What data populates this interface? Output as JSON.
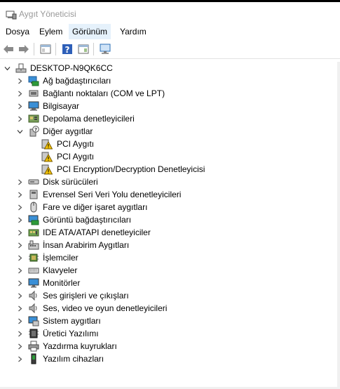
{
  "window": {
    "title": "Aygıt Yöneticisi"
  },
  "menu": [
    "Dosya",
    "Eylem",
    "Görünüm",
    "Yardım"
  ],
  "toolbar": {
    "buttons": [
      "back-arrow-icon",
      "forward-arrow-icon",
      "properties-pane-icon",
      "help-icon",
      "device-properties-icon",
      "monitor-scan-icon"
    ]
  },
  "tree": {
    "root": "DESKTOP-N9QK6CC",
    "items": [
      {
        "label": "Ağ bağdaştırıcıları",
        "icon": "network-adapter-icon",
        "expanded": false
      },
      {
        "label": "Bağlantı noktaları (COM ve LPT)",
        "icon": "port-icon",
        "expanded": false
      },
      {
        "label": "Bilgisayar",
        "icon": "computer-icon",
        "expanded": false
      },
      {
        "label": "Depolama denetleyicileri",
        "icon": "storage-controller-icon",
        "expanded": false
      },
      {
        "label": "Diğer aygıtlar",
        "icon": "other-devices-icon",
        "expanded": true,
        "children": [
          "PCI Aygıtı",
          "PCI Aygıtı",
          "PCI Encryption/Decryption Denetleyicisi"
        ]
      },
      {
        "label": "Disk sürücüleri",
        "icon": "disk-drive-icon",
        "expanded": false
      },
      {
        "label": "Evrensel Seri Veri Yolu denetleyicileri",
        "icon": "usb-controller-icon",
        "expanded": false
      },
      {
        "label": "Fare ve diğer işaret aygıtları",
        "icon": "mouse-icon",
        "expanded": false
      },
      {
        "label": "Görüntü bağdaştırıcıları",
        "icon": "display-adapter-icon",
        "expanded": false
      },
      {
        "label": "IDE ATA/ATAPI denetleyiciler",
        "icon": "ide-controller-icon",
        "expanded": false
      },
      {
        "label": "İnsan Arabirim Aygıtları",
        "icon": "hid-icon",
        "expanded": false
      },
      {
        "label": "İşlemciler",
        "icon": "processor-icon",
        "expanded": false
      },
      {
        "label": "Klavyeler",
        "icon": "keyboard-icon",
        "expanded": false
      },
      {
        "label": "Monitörler",
        "icon": "monitor-icon",
        "expanded": false
      },
      {
        "label": "Ses girişleri ve çıkışları",
        "icon": "audio-io-icon",
        "expanded": false
      },
      {
        "label": "Ses, video ve oyun denetleyicileri",
        "icon": "sound-controller-icon",
        "expanded": false
      },
      {
        "label": "Sistem aygıtları",
        "icon": "system-devices-icon",
        "expanded": false
      },
      {
        "label": "Üretici Yazılımı",
        "icon": "firmware-icon",
        "expanded": false
      },
      {
        "label": "Yazdırma kuyrukları",
        "icon": "printer-icon",
        "expanded": false
      },
      {
        "label": "Yazılım cihazları",
        "icon": "software-device-icon",
        "expanded": false
      }
    ]
  }
}
